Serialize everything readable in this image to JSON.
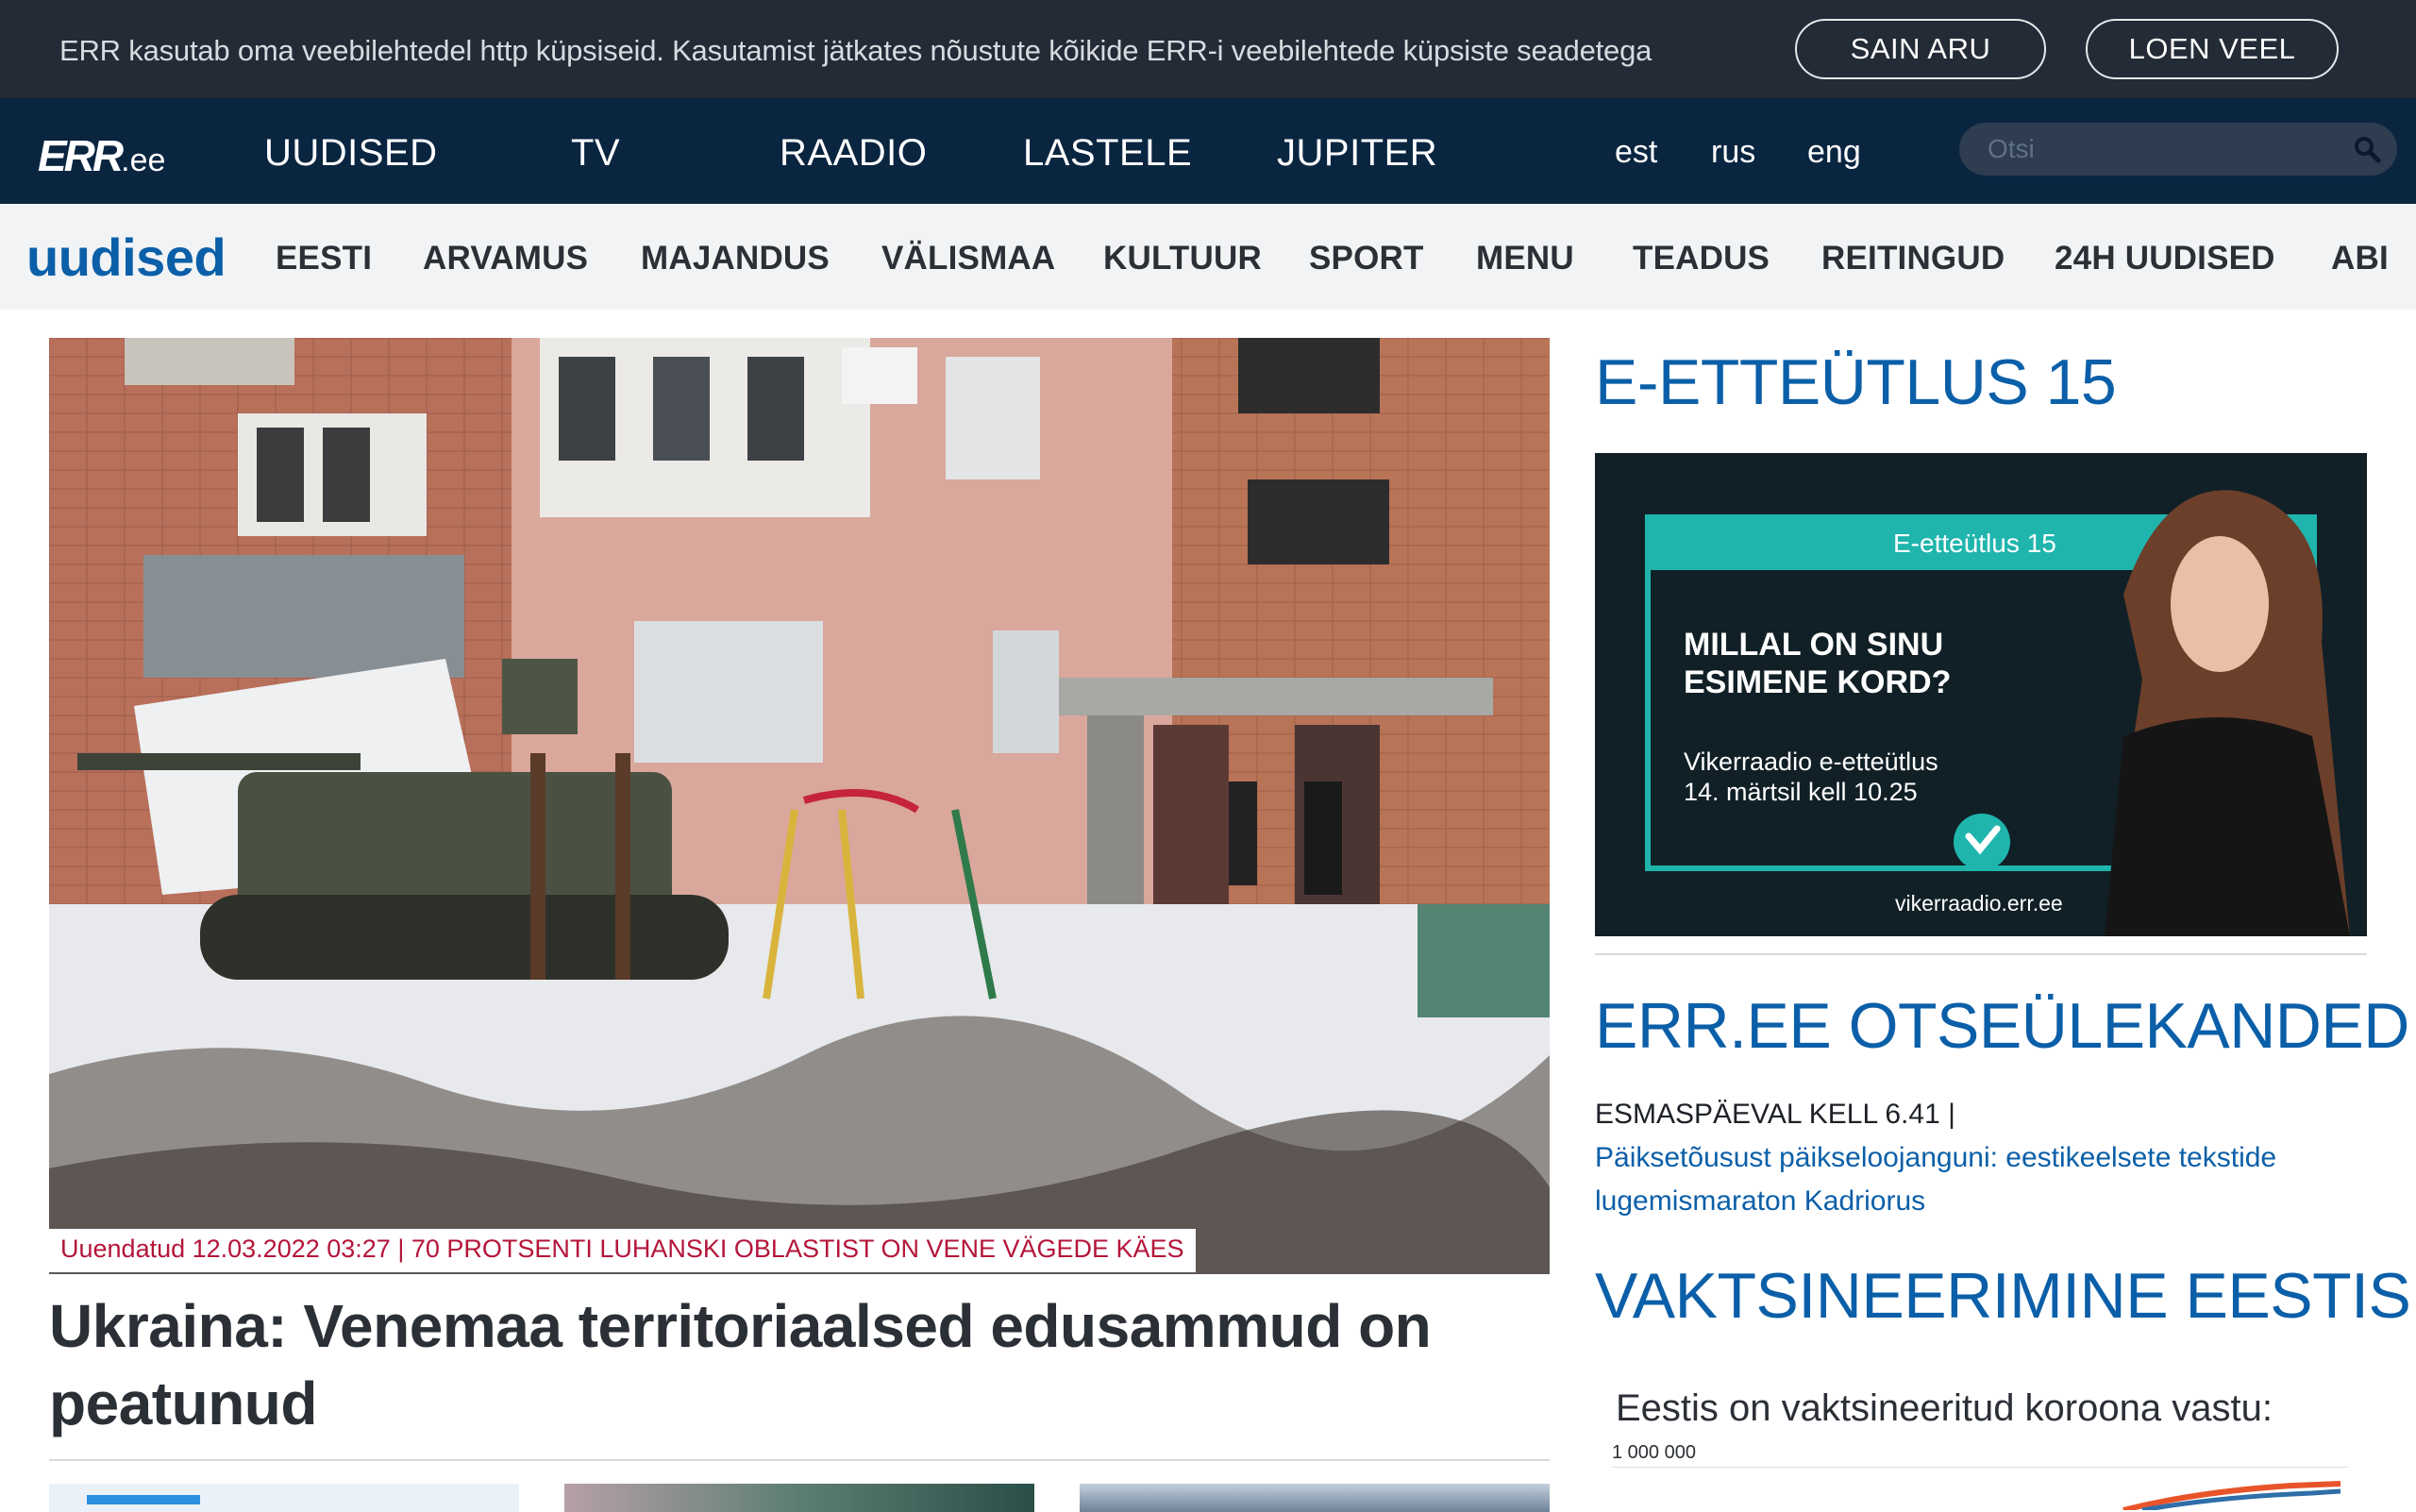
{
  "cookie_bar": {
    "text": "ERR kasutab oma veebilehtedel http küpsiseid. Kasutamist jätkates nõustute kõikide ERR-i veebilehtede küpsiste seadetega",
    "accept_label": "SAIN ARU",
    "more_label": "LOEN VEEL"
  },
  "main_nav": {
    "logo": "ERR",
    "logo_suffix": ".ee",
    "items": [
      "UUDISED",
      "TV",
      "RAADIO",
      "LASTELE",
      "JUPITER"
    ],
    "languages": [
      "est",
      "rus",
      "eng"
    ],
    "search_placeholder": "Otsi"
  },
  "sub_nav": {
    "brand": "uudised",
    "items": [
      "EESTI",
      "ARVAMUS",
      "MAJANDUS",
      "VÄLISMAA",
      "KULTUUR",
      "SPORT",
      "MENU",
      "TEADUS",
      "REITINGUD",
      "24H UUDISED",
      "ABI"
    ]
  },
  "hero": {
    "caption": "Uuendatud 12.03.2022 03:27 | 70 PROTSENTI LUHANSKI OBLASTIST ON VENE VÄGEDE KÄES",
    "title": "Ukraina: Venemaa territoriaalsed edusammud on peatunud"
  },
  "sidebar": {
    "promo_heading": "E-ETTEÜTLUS 15",
    "promo": {
      "tag": "E-etteütlus 15",
      "headline_1": "MILLAL ON SINU",
      "headline_2": "ESIMENE KORD?",
      "line_1": "Vikerraadio e-etteütlus",
      "line_2": "14. märtsil kell 10.25",
      "url": "vikerraadio.err.ee"
    },
    "live_heading": "ERR.EE OTSEÜLEKANDED",
    "live_time": "ESMASPÄEVAL KELL 6.41 |",
    "live_link": "Päiksetõusust päikseloojanguni: eestikeelsete tekstide lugemismaraton Kadriorus",
    "vax_heading": "VAKTSINEERIMINE EESTIS",
    "vax_title": "Eestis on vaktsineeritud koroona vastu:",
    "vax_axis_label": "1 000 000"
  },
  "colors": {
    "accent_blue": "#0b5fa8",
    "nav_dark": "#0a2540",
    "cookie_dark": "#232b36",
    "caption_red": "#b4153a"
  }
}
